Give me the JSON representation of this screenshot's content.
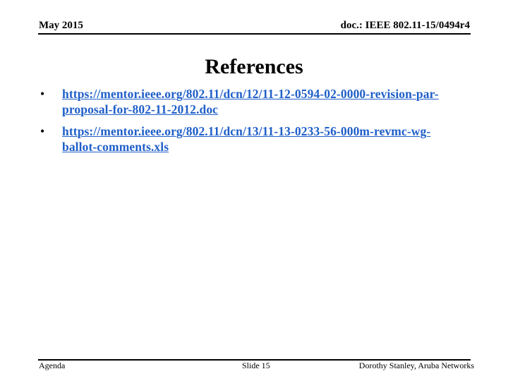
{
  "header": {
    "date": "May 2015",
    "doc_id": "doc.: IEEE 802.11-15/0494r4"
  },
  "slide": {
    "title": "References",
    "bullets": [
      {
        "bullet": "•",
        "text": "https://mentor.ieee.org/802.11/dcn/12/11-12-0594-02-0000-revision-par-proposal-for-802-11-2012.doc",
        "line1": "https://mentor.ieee.org/802.11/dcn/12/11-12-0594-02-0000-revision-par-",
        "line2": "proposal-for-802-11-2012.doc"
      },
      {
        "bullet": "•",
        "text": "https://mentor.ieee.org/802.11/dcn/13/11-13-0233-56-000m-revmc-wg-ballot-comments.xls",
        "line1": "https://mentor.ieee.org/802.11/dcn/13/11-13-0233-56-000m-revmc-wg-",
        "line2": "ballot-comments.xls"
      }
    ]
  },
  "footer": {
    "left": "Agenda",
    "center": "Slide 15",
    "right": "Dorothy Stanley, Aruba Networks"
  },
  "colors": {
    "link": "#1f5fc9",
    "text": "#000000",
    "background": "#ffffff"
  }
}
